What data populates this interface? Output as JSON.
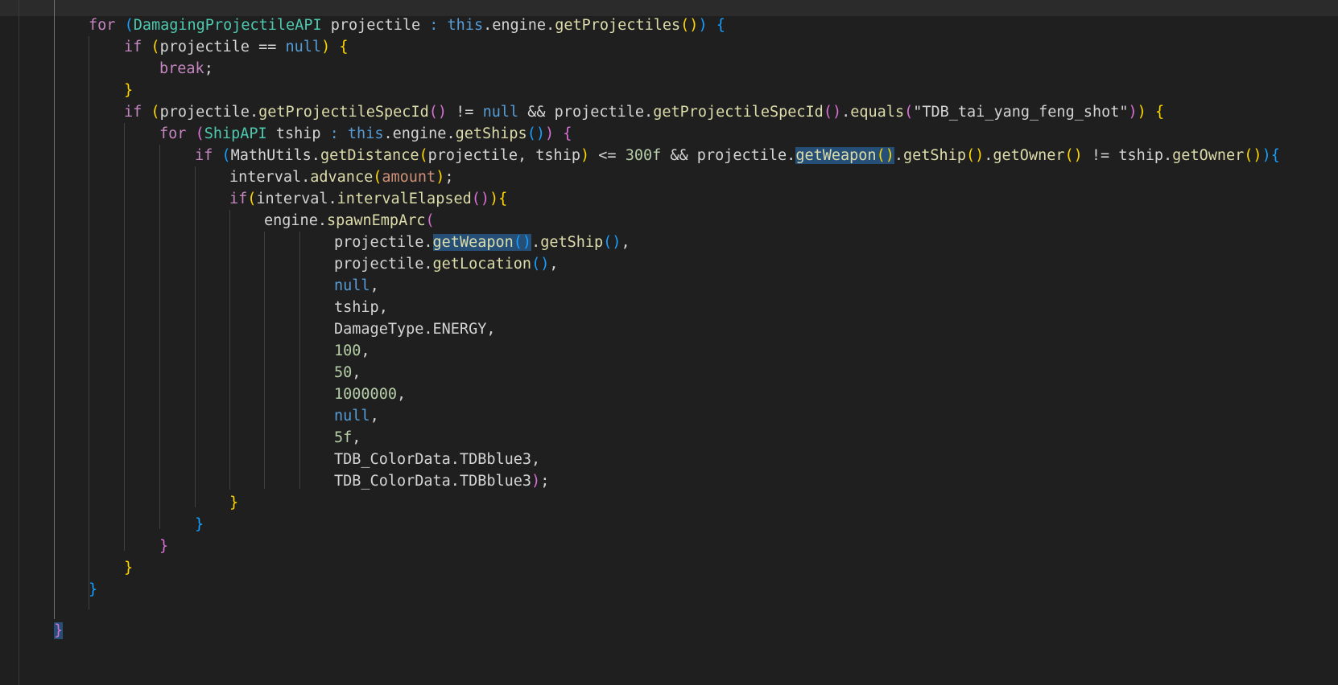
{
  "code_lines": [
    [
      [
        "for",
        "kw"
      ],
      [
        " ",
        "txt"
      ],
      [
        "(",
        "b3"
      ],
      [
        "DamagingProjectileAPI",
        "ty"
      ],
      [
        " projectile ",
        "txt"
      ],
      [
        ":",
        "kw2"
      ],
      [
        " ",
        "txt"
      ],
      [
        "this",
        "kw2"
      ],
      [
        ".engine.",
        "txt"
      ],
      [
        "getProjectiles",
        "fn"
      ],
      [
        "()",
        "b1"
      ],
      [
        ")",
        "b3"
      ],
      [
        " ",
        "txt"
      ],
      [
        "{",
        "b3"
      ]
    ],
    [
      [
        "if",
        "kw"
      ],
      [
        " ",
        "txt"
      ],
      [
        "(",
        "b1"
      ],
      [
        "projectile == ",
        "txt"
      ],
      [
        "null",
        "kw2"
      ],
      [
        ")",
        "b1"
      ],
      [
        " ",
        "txt"
      ],
      [
        "{",
        "b1"
      ]
    ],
    [
      [
        "break",
        "kw"
      ],
      [
        ";",
        "txt"
      ]
    ],
    [
      [
        "}",
        "b1"
      ]
    ],
    [
      [
        "if",
        "kw"
      ],
      [
        " ",
        "txt"
      ],
      [
        "(",
        "b1"
      ],
      [
        "projectile.",
        "txt"
      ],
      [
        "getProjectileSpecId",
        "fn"
      ],
      [
        "()",
        "b2"
      ],
      [
        " != ",
        "txt"
      ],
      [
        "null",
        "kw2"
      ],
      [
        " && projectile.",
        "txt"
      ],
      [
        "getProjectileSpecId",
        "fn"
      ],
      [
        "()",
        "b2"
      ],
      [
        ".",
        "txt"
      ],
      [
        "equals",
        "fn"
      ],
      [
        "(",
        "b2"
      ],
      [
        "\"TDB_tai_yang_feng_shot\"",
        "txt"
      ],
      [
        ")",
        "b2"
      ],
      [
        ")",
        "b1"
      ],
      [
        " ",
        "txt"
      ],
      [
        "{",
        "b1"
      ]
    ],
    [
      [
        "for",
        "kw"
      ],
      [
        " ",
        "txt"
      ],
      [
        "(",
        "b2"
      ],
      [
        "ShipAPI",
        "ty"
      ],
      [
        " tship ",
        "txt"
      ],
      [
        ":",
        "kw2"
      ],
      [
        " ",
        "txt"
      ],
      [
        "this",
        "kw2"
      ],
      [
        ".engine.",
        "txt"
      ],
      [
        "getShips",
        "fn"
      ],
      [
        "()",
        "b3"
      ],
      [
        ")",
        "b2"
      ],
      [
        " ",
        "txt"
      ],
      [
        "{",
        "b2"
      ]
    ],
    [
      [
        "if",
        "kw"
      ],
      [
        " ",
        "txt"
      ],
      [
        "(",
        "b3"
      ],
      [
        "MathUtils.",
        "txt"
      ],
      [
        "getDistance",
        "fn"
      ],
      [
        "(",
        "b1"
      ],
      [
        "projectile, tship",
        "txt"
      ],
      [
        ")",
        "b1"
      ],
      [
        " <= ",
        "txt"
      ],
      [
        "300f",
        "num"
      ],
      [
        " && projectile.",
        "txt"
      ],
      [
        "getWeapon",
        "fn hl"
      ],
      [
        "()",
        "b1 hl"
      ],
      [
        ".",
        "txt"
      ],
      [
        "getShip",
        "fn"
      ],
      [
        "()",
        "b1"
      ],
      [
        ".",
        "txt"
      ],
      [
        "getOwner",
        "fn"
      ],
      [
        "()",
        "b1"
      ],
      [
        " != tship.",
        "txt"
      ],
      [
        "getOwner",
        "fn"
      ],
      [
        "()",
        "b1"
      ],
      [
        ")",
        "b3"
      ],
      [
        "{",
        "b3"
      ]
    ],
    [
      [
        "interval.",
        "txt"
      ],
      [
        "advance",
        "fn"
      ],
      [
        "(",
        "b1"
      ],
      [
        "amount",
        "str"
      ],
      [
        ")",
        "b1"
      ],
      [
        ";",
        "txt"
      ]
    ],
    [
      [
        "if",
        "kw"
      ],
      [
        "(",
        "b1"
      ],
      [
        "interval.",
        "txt"
      ],
      [
        "intervalElapsed",
        "fn"
      ],
      [
        "()",
        "b2"
      ],
      [
        ")",
        "b1"
      ],
      [
        "{",
        "b1"
      ]
    ],
    [
      [
        "engine.",
        "txt"
      ],
      [
        "spawnEmpArc",
        "fn"
      ],
      [
        "(",
        "b2"
      ]
    ],
    [
      [
        "projectile.",
        "txt"
      ],
      [
        "getWeapon",
        "fn hl"
      ],
      [
        "()",
        "b3 hl"
      ],
      [
        ".",
        "txt"
      ],
      [
        "getShip",
        "fn"
      ],
      [
        "()",
        "b3"
      ],
      [
        ",",
        "txt"
      ]
    ],
    [
      [
        "projectile.",
        "txt"
      ],
      [
        "getLocation",
        "fn"
      ],
      [
        "()",
        "b3"
      ],
      [
        ",",
        "txt"
      ]
    ],
    [
      [
        "null",
        "kw2"
      ],
      [
        ",",
        "txt"
      ]
    ],
    [
      [
        "tship,",
        "txt"
      ]
    ],
    [
      [
        "DamageType.ENERGY,",
        "txt"
      ]
    ],
    [
      [
        "100",
        "num"
      ],
      [
        ",",
        "txt"
      ]
    ],
    [
      [
        "50",
        "num"
      ],
      [
        ",",
        "txt"
      ]
    ],
    [
      [
        "1000000",
        "num"
      ],
      [
        ",",
        "txt"
      ]
    ],
    [
      [
        "null",
        "kw2"
      ],
      [
        ",",
        "txt"
      ]
    ],
    [
      [
        "5f",
        "num"
      ],
      [
        ",",
        "txt"
      ]
    ],
    [
      [
        "TDB_ColorData.TDBblue3,",
        "txt"
      ]
    ],
    [
      [
        "TDB_ColorData.TDBblue3",
        "txt"
      ],
      [
        ")",
        "b2"
      ],
      [
        ";",
        "txt"
      ]
    ],
    [
      [
        "}",
        "b1"
      ]
    ],
    [
      [
        "}",
        "b3"
      ]
    ],
    [
      [
        "}",
        "b2"
      ]
    ],
    [
      [
        "}",
        "b1"
      ]
    ],
    [
      [
        "}",
        "b3"
      ]
    ],
    [],
    [
      [
        "}",
        "b2 hl"
      ]
    ]
  ]
}
